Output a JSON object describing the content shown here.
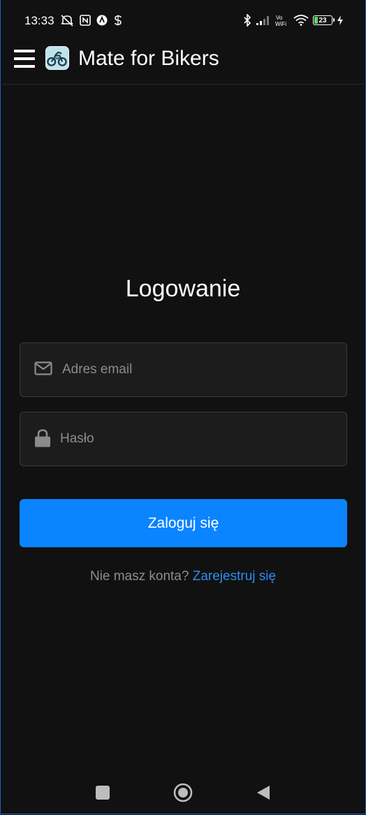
{
  "status_bar": {
    "time": "13:33",
    "network_label": "Vo\nWiFi",
    "battery_level": "23",
    "battery_fill_percent": 23,
    "battery_color": "#5fd35f",
    "icons": [
      "muted-icon",
      "nfc-icon",
      "app-a-icon",
      "app-s-icon",
      "bluetooth-icon",
      "signal-icon",
      "vowifi-icon",
      "wifi-icon",
      "battery-icon",
      "charging-icon"
    ]
  },
  "app_bar": {
    "title": "Mate for Bikers",
    "menu_icon": "hamburger-menu-icon",
    "logo_icon": "motorcycle-logo-icon"
  },
  "login": {
    "title": "Logowanie",
    "email_placeholder": "Adres email",
    "email_value": "",
    "email_icon": "envelope-icon",
    "password_placeholder": "Hasło",
    "password_value": "",
    "password_icon": "lock-icon",
    "submit_label": "Zaloguj się",
    "no_account_text": "Nie masz konta?",
    "register_link": "Zarejestruj się"
  },
  "colors": {
    "background": "#111111",
    "accent": "#0a84ff",
    "link": "#2d8cf0",
    "field_bg": "#1c1c1c",
    "field_border": "#3a3a3a",
    "muted_text": "#8e8e8e"
  },
  "nav_bar": {
    "buttons": [
      "recent-apps",
      "home",
      "back"
    ]
  }
}
